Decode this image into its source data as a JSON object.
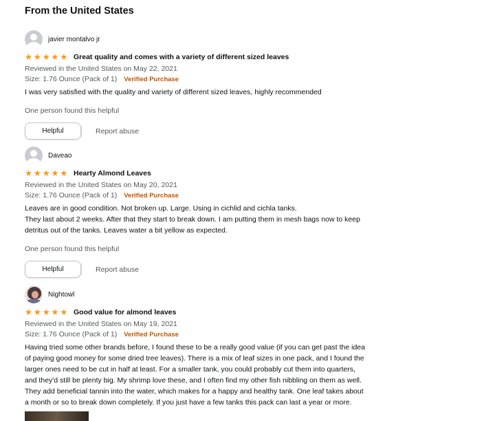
{
  "section": {
    "title": "From the United States"
  },
  "reviews": [
    {
      "name": "javier montalvo jr",
      "rating": 5,
      "title": "Great quality and comes with a variety of different sized leaves",
      "reviewed": "Reviewed in the United States on May 22, 2021",
      "size": "Size: 1.76 Ounce (Pack of 1)",
      "verified": "Verified Purchase",
      "text": [
        "I was very satisfied with the quality and variety of different sized leaves, highly recommended"
      ],
      "helpful_text": "One person found this helpful",
      "helpful_button": "Helpful",
      "report": "Report abuse"
    },
    {
      "name": "Daveao",
      "rating": 5,
      "title": "Hearty Almond Leaves",
      "reviewed": "Reviewed in the United States on May 20, 2021",
      "size": "Size: 1.76 Ounce (Pack of 1)",
      "verified": "Verified Purchase",
      "text": [
        "Leaves are in good condition. Not broken up. Large. Using in cichlid and cichla tanks.",
        "They last about 2 weeks. After that they start to break down. I am putting them in mesh bags now to keep",
        "detritus out of the tanks. Leaves water a bit yellow as expected."
      ],
      "helpful_text": "One person found this helpful",
      "helpful_button": "Helpful",
      "report": "Report abuse"
    },
    {
      "name": "Nightowl",
      "rating": 5,
      "title": "Good value for almond leaves",
      "reviewed": "Reviewed in the United States on May 19, 2021",
      "size": "Size: 1.76 Ounce (Pack of 1)",
      "verified": "Verified Purchase",
      "text": [
        "Having tried some other brands before, I found these to be a really good value (if you can get past the idea",
        "of paying good money for some dried tree leaves). There is a mix of leaf sizes in one pack, and I found the",
        "larger ones need to be cut in half at least. For a smaller tank, you could probably cut them into quarters,",
        "and they'd still be plenty big. My shrimp love these, and I often find my other fish nibbling on them as well.",
        "They add beneficial tannin into the water, which makes for a happy and healthy tank. One leaf takes about",
        "a month or so to break down completely. If you just have a few tanks this pack can last a year or more."
      ]
    }
  ]
}
